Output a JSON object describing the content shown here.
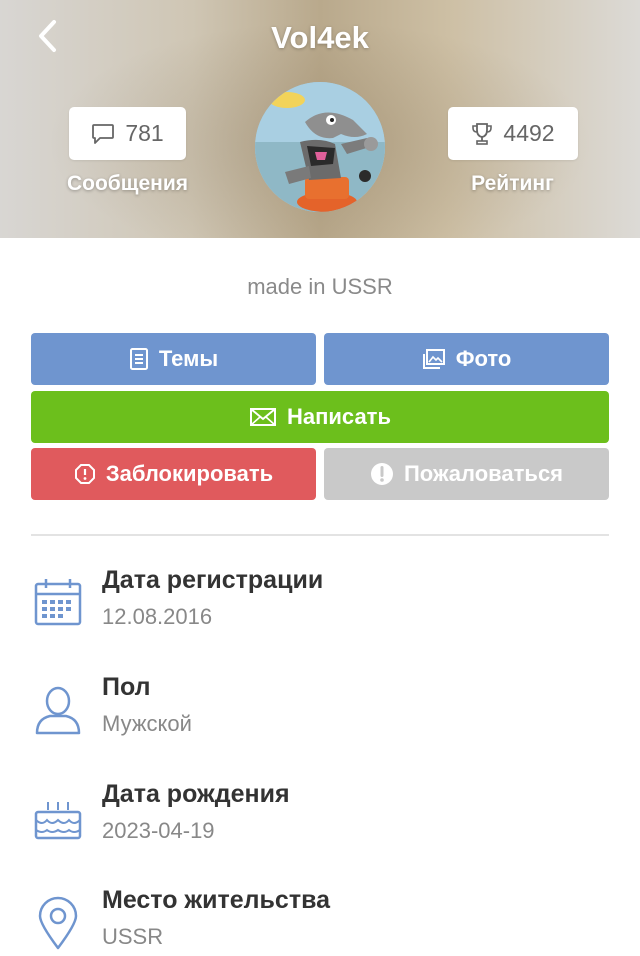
{
  "header": {
    "username": "Vol4ek",
    "messages": {
      "count": "781",
      "label": "Сообщения",
      "icon": "comment-icon"
    },
    "rating": {
      "count": "4492",
      "label": "Рейтинг",
      "icon": "trophy-icon"
    }
  },
  "profile": {
    "about": "made in USSR"
  },
  "actions": {
    "topics": "Темы",
    "photo": "Фото",
    "write": "Написать",
    "block": "Заблокировать",
    "report": "Пожаловаться"
  },
  "info": [
    {
      "label": "Дата регистрации",
      "value": "12.08.2016",
      "icon": "calendar-icon"
    },
    {
      "label": "Пол",
      "value": "Мужской",
      "icon": "user-icon"
    },
    {
      "label": "Дата рождения",
      "value": "2023-04-19",
      "icon": "birthday-cake-icon"
    },
    {
      "label": "Место жительства",
      "value": "USSR",
      "icon": "location-pin-icon"
    }
  ],
  "colors": {
    "blue_button": "#6f95cf",
    "green_button": "#6cbf1c",
    "red_button": "#e05a5d",
    "gray_button": "#c9c9c9",
    "icon_blue": "#6f95cf"
  }
}
